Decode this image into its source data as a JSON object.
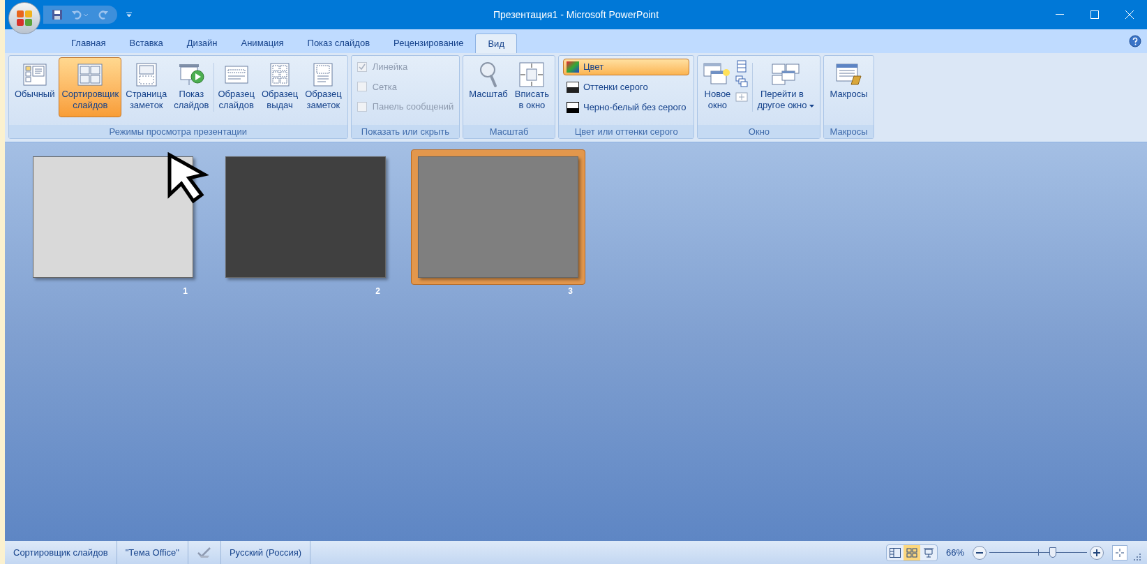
{
  "window": {
    "title": "Презентация1 - Microsoft PowerPoint"
  },
  "tabs": [
    {
      "label": "Главная",
      "selected": false
    },
    {
      "label": "Вставка",
      "selected": false
    },
    {
      "label": "Дизайн",
      "selected": false
    },
    {
      "label": "Анимация",
      "selected": false
    },
    {
      "label": "Показ слайдов",
      "selected": false
    },
    {
      "label": "Рецензирование",
      "selected": false
    },
    {
      "label": "Вид",
      "selected": true
    }
  ],
  "ribbon": {
    "groups": [
      {
        "title": "Режимы просмотра презентации",
        "items": [
          {
            "kind": "normal",
            "label": "Обычный",
            "selected": false
          },
          {
            "kind": "sorter",
            "label": "Сортировщик\nслайдов",
            "selected": true
          },
          {
            "kind": "notes",
            "label": "Страница\nзаметок",
            "selected": false
          },
          {
            "kind": "show",
            "label": "Показ\nслайдов",
            "selected": false
          },
          {
            "kind": "separator"
          },
          {
            "kind": "slide-master",
            "label": "Образец\nслайдов",
            "selected": false
          },
          {
            "kind": "handout-master",
            "label": "Образец\nвыдач",
            "selected": false
          },
          {
            "kind": "notes-master",
            "label": "Образец\nзаметок",
            "selected": false
          }
        ]
      },
      {
        "title": "Показать или скрыть",
        "checks": [
          {
            "label": "Линейка",
            "checked": true,
            "disabled": true
          },
          {
            "label": "Сетка",
            "checked": false,
            "disabled": true
          },
          {
            "label": "Панель сообщений",
            "checked": false,
            "disabled": true
          }
        ]
      },
      {
        "title": "Масштаб",
        "items": [
          {
            "kind": "zoom",
            "label": "Масштаб",
            "selected": false
          },
          {
            "kind": "fit",
            "label": "Вписать\nв окно",
            "selected": false
          }
        ]
      },
      {
        "title": "Цвет или оттенки серого",
        "options": [
          {
            "kind": "color",
            "label": "Цвет",
            "selected": true
          },
          {
            "kind": "grayscale",
            "label": "Оттенки серого",
            "selected": false
          },
          {
            "kind": "bw",
            "label": "Черно-белый без серого",
            "selected": false
          }
        ]
      },
      {
        "title": "Окно",
        "items": [
          {
            "kind": "new-window",
            "label": "Новое\nокно",
            "selected": false
          },
          {
            "kind": "small-stack"
          },
          {
            "kind": "separator"
          },
          {
            "kind": "switch-window",
            "label": "Перейти в\nдругое окно",
            "selected": false,
            "dropdown": true
          }
        ]
      },
      {
        "title": "Макросы",
        "items": [
          {
            "kind": "macros",
            "label": "Макросы",
            "selected": false
          }
        ]
      }
    ]
  },
  "slides": [
    {
      "number": "1",
      "color": "#d9d9d9",
      "selected": false
    },
    {
      "number": "2",
      "color": "#404040",
      "selected": false
    },
    {
      "number": "3",
      "color": "#7f7f7f",
      "selected": true
    }
  ],
  "status_bar": {
    "items": [
      {
        "kind": "text",
        "label": "Сортировщик слайдов"
      },
      {
        "kind": "text",
        "label": "\"Тема Office\""
      },
      {
        "kind": "spell"
      },
      {
        "kind": "text",
        "label": "Русский (Россия)"
      }
    ],
    "views": [
      {
        "kind": "normal",
        "selected": false
      },
      {
        "kind": "sorter",
        "selected": true
      },
      {
        "kind": "show",
        "selected": false
      }
    ],
    "zoom": "66%",
    "zoom_slider": {
      "level": 0.65
    }
  }
}
